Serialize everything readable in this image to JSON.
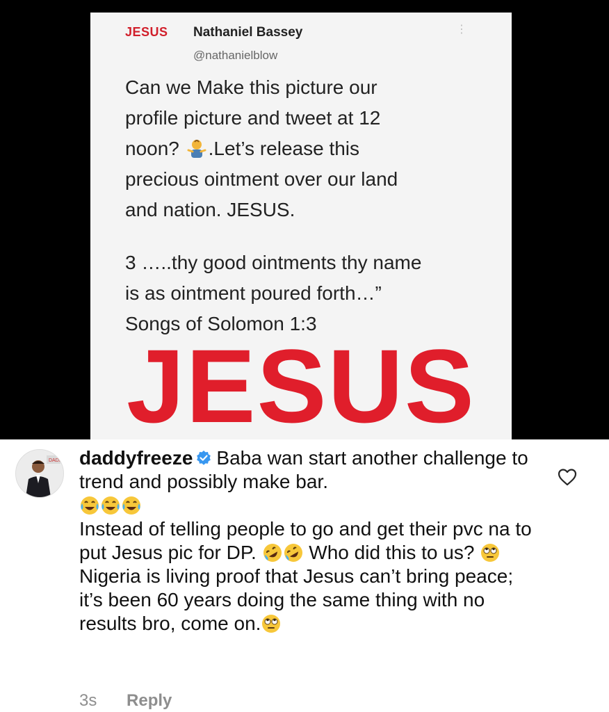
{
  "tweet": {
    "avatar_text": "JESUS",
    "name": "Nathaniel Bassey",
    "handle": "@nathanielblow",
    "line1": "Can we Make this picture our",
    "line2": "profile picture and tweet at 12",
    "line3_a": "noon? ",
    "line3_b": ".Let’s release this",
    "line4": "precious ointment over our land",
    "line5": "and nation. JESUS.",
    "quote1": "3 …..thy good ointments thy name",
    "quote2": "is as ointment poured forth…”",
    "quote3": "Songs of Solomon 1:3",
    "big_word": "JESUS",
    "accent_color": "#e01e2b"
  },
  "comment": {
    "username": "daddyfreeze",
    "part1": "Baba wan start another challenge to trend and possibly make bar.",
    "part2": "Instead of telling people to go and get their pvc na to put Jesus pic for DP.",
    "part3": "Who did this to us?",
    "part4": "Nigeria is living proof that Jesus can’t bring peace; it’s been 60 years doing the same thing with no results   bro, come on.",
    "time": "3s",
    "reply_label": "Reply"
  },
  "icons": {
    "verified": "verified-badge-icon",
    "heart": "heart-outline-icon",
    "laughing": "tears-of-joy-emoji",
    "rolling": "rolling-on-floor-laughing-emoji",
    "eyeroll": "eye-roll-emoji",
    "shrug": "person-shrugging-emoji"
  }
}
